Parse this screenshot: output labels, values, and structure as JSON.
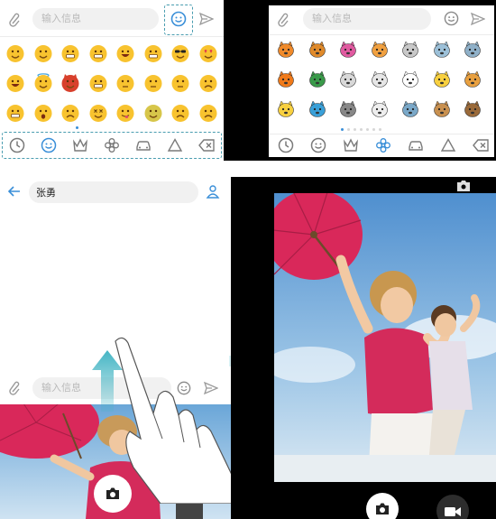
{
  "emoji_panel": {
    "input_placeholder": "输入信息",
    "tabs": [
      "recent-clock-icon",
      "smiley-icon",
      "crown-icon",
      "flower-icon",
      "car-icon",
      "triangle-icon",
      "backspace-icon"
    ],
    "active_tab_index": 1
  },
  "animal_panel": {
    "input_placeholder": "输入信息",
    "tabs": [
      "recent-clock-icon",
      "smiley-icon",
      "crown-icon",
      "flower-icon",
      "car-icon",
      "triangle-icon",
      "backspace-icon"
    ],
    "active_tab_index": 3
  },
  "chat_panel": {
    "contact_name": "张勇",
    "input_placeholder": "输入信息"
  },
  "colors": {
    "accent": "#3a8fd8",
    "arrow": "#45b5c4",
    "emoji_yellow": "#f8c32f",
    "umbrella": "#d9285a"
  }
}
